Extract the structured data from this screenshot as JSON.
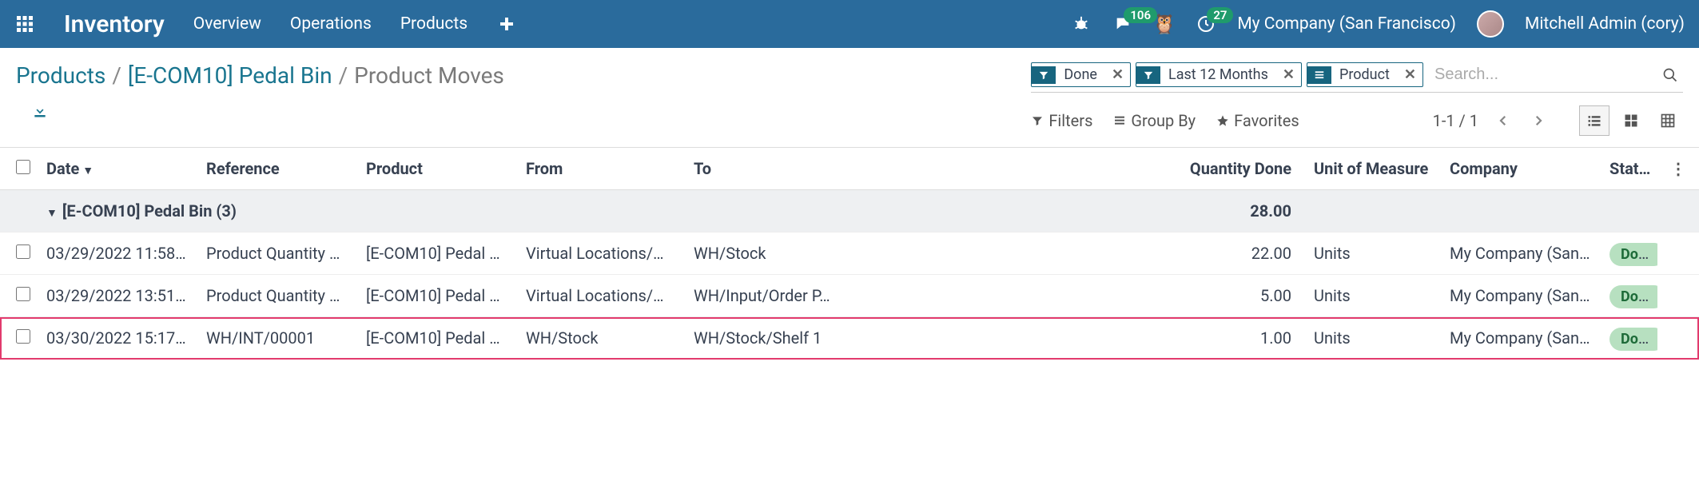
{
  "nav": {
    "brand": "Inventory",
    "links": [
      "Overview",
      "Operations",
      "Products"
    ],
    "msg_badge": "106",
    "activity_badge": "27",
    "company": "My Company (San Francisco)",
    "user": "Mitchell Admin (cory)"
  },
  "breadcrumb": {
    "root": "Products",
    "mid": "[E-COM10] Pedal Bin",
    "current": "Product Moves"
  },
  "search": {
    "facets": [
      {
        "kind": "filter",
        "label": "Done"
      },
      {
        "kind": "filter",
        "label": "Last 12 Months"
      },
      {
        "kind": "group",
        "label": "Product"
      }
    ],
    "placeholder": "Search..."
  },
  "toolbar": {
    "filters": "Filters",
    "groupby": "Group By",
    "favorites": "Favorites",
    "pager": "1-1 / 1"
  },
  "columns": {
    "date": "Date",
    "reference": "Reference",
    "product": "Product",
    "from": "From",
    "to": "To",
    "qty": "Quantity Done",
    "uom": "Unit of Measure",
    "company": "Company",
    "status": "Stat…"
  },
  "group": {
    "title": "[E-COM10] Pedal Bin (3)",
    "qty_total": "28.00"
  },
  "rows": [
    {
      "date": "03/29/2022 11:58…",
      "reference": "Product Quantity …",
      "product": "[E-COM10] Pedal …",
      "from": "Virtual Locations/…",
      "to": "WH/Stock",
      "qty": "22.00",
      "uom": "Units",
      "company": "My Company (San…",
      "status": "Done"
    },
    {
      "date": "03/29/2022 13:51…",
      "reference": "Product Quantity …",
      "product": "[E-COM10] Pedal …",
      "from": "Virtual Locations/…",
      "to": "WH/Input/Order P…",
      "qty": "5.00",
      "uom": "Units",
      "company": "My Company (San…",
      "status": "Done"
    },
    {
      "date": "03/30/2022 15:17…",
      "reference": "WH/INT/00001",
      "product": "[E-COM10] Pedal …",
      "from": "WH/Stock",
      "to": "WH/Stock/Shelf 1",
      "qty": "1.00",
      "uom": "Units",
      "company": "My Company (San…",
      "status": "Done"
    }
  ]
}
